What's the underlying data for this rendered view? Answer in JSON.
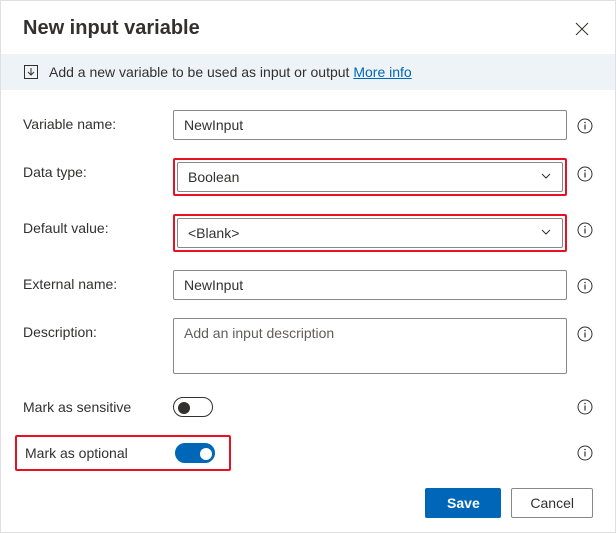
{
  "dialog": {
    "title": "New input variable",
    "info_text": "Add a new variable to be used as input or output",
    "more_info": "More info"
  },
  "labels": {
    "variable_name": "Variable name:",
    "data_type": "Data type:",
    "default_value": "Default value:",
    "external_name": "External name:",
    "description": "Description:",
    "mark_sensitive": "Mark as sensitive",
    "mark_optional": "Mark as optional"
  },
  "values": {
    "variable_name": "NewInput",
    "data_type": "Boolean",
    "default_value": "<Blank>",
    "external_name": "NewInput"
  },
  "placeholders": {
    "description": "Add an input description"
  },
  "toggles": {
    "sensitive": false,
    "optional": true
  },
  "buttons": {
    "save": "Save",
    "cancel": "Cancel"
  }
}
